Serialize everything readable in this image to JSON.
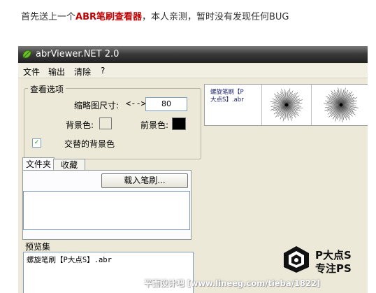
{
  "intro": {
    "before": "首先送上一个",
    "highlight": "ABR笔刷查看器",
    "after": "，本人亲测，暂时没有发现任何BUG"
  },
  "window": {
    "title": "abrViewer.NET 2.0",
    "menu": [
      "文件",
      "输出",
      "清除",
      "?"
    ]
  },
  "view_options": {
    "group_title": "查看选项",
    "thumb_size_label": "缩略图尺寸:",
    "arrow": "<-->",
    "thumb_size_value": "80",
    "bg_color_label": "背景色:",
    "fg_color_label": "前景色:",
    "alternate_bg_label": "交替的背景色",
    "alternate_bg_checked": true,
    "colors": {
      "background": "#ece9d8",
      "foreground": "#000000"
    }
  },
  "tabs": [
    {
      "label": "文件夹",
      "active": true
    },
    {
      "label": "收藏",
      "active": false
    }
  ],
  "load_brush_button": "载入笔刷...",
  "presets": {
    "label": "预览集",
    "items": [
      "螺旋笔刷【P大点S】.abr"
    ]
  },
  "preview": {
    "name_line1": "螺旋笔刷【P",
    "name_line2": "大点S】.abr"
  },
  "logo": {
    "line1": "P大点S",
    "line2": "专注PS"
  },
  "watermark": "平面设计吧 [www.lineeg.com/tieba/1822]"
}
